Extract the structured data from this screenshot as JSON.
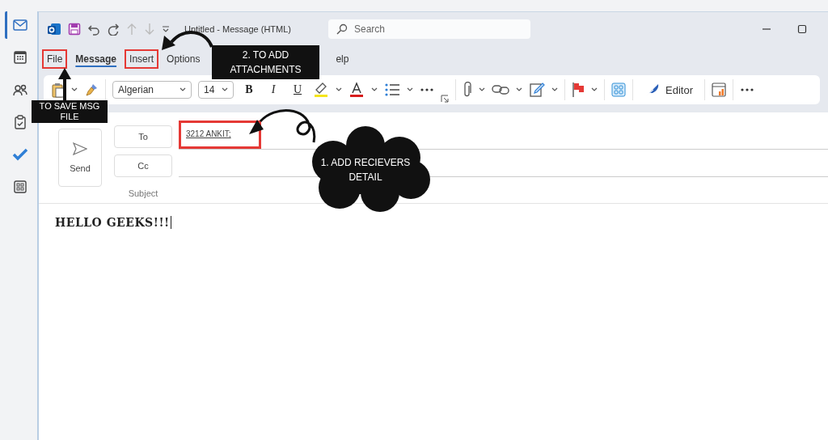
{
  "window": {
    "title": "Untitled  -  Message (HTML)",
    "search": {
      "placeholder": "Search"
    }
  },
  "rail": [
    {
      "kind": "mail",
      "selected": true
    },
    {
      "kind": "calendar",
      "selected": false
    },
    {
      "kind": "people",
      "selected": false
    },
    {
      "kind": "tasks",
      "selected": false
    },
    {
      "kind": "todo",
      "selected": false
    },
    {
      "kind": "apps",
      "selected": false
    }
  ],
  "tabs": [
    {
      "label": "File",
      "selected": false,
      "highlighted": true
    },
    {
      "label": "Message",
      "selected": true,
      "highlighted": false
    },
    {
      "label": "Insert",
      "selected": false,
      "highlighted": true
    },
    {
      "label": "Options",
      "selected": false,
      "highlighted": false
    },
    {
      "label": "elp",
      "selected": false,
      "highlighted": false
    }
  ],
  "ribbon": {
    "font": "Algerian",
    "size": "14",
    "format": [
      "B",
      "I",
      "U"
    ],
    "editor": "Editor"
  },
  "compose": {
    "send": "Send",
    "to": "To",
    "cc": "Cc",
    "subject": "Subject",
    "recipient": {
      "text": "3212 ANKIT;",
      "highlighted": true
    },
    "body": "HELLO GEEKS!!!"
  },
  "callouts": [
    {
      "kind": "label",
      "text": "2. TO ADD ATTACHMENTS"
    },
    {
      "kind": "label",
      "text": "TO SAVE MSG FILE"
    },
    {
      "kind": "cloud",
      "text": "1.    ADD RECIEVERS DETAIL"
    }
  ]
}
